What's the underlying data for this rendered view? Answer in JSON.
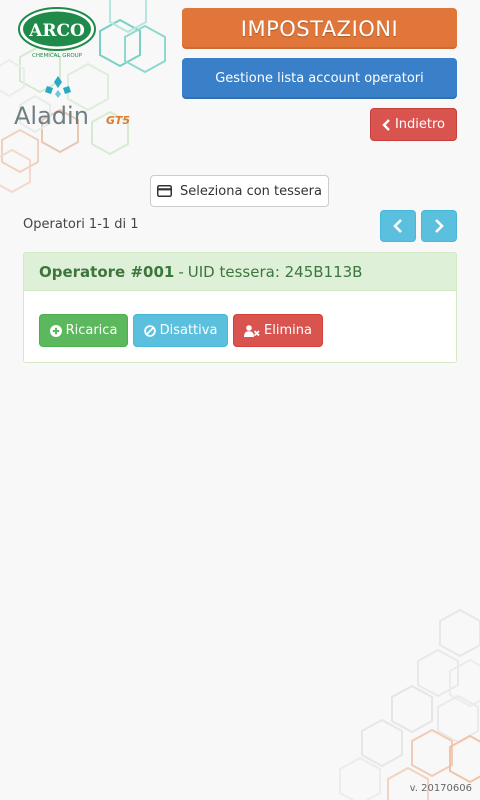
{
  "header": {
    "title": "IMPOSTAZIONI",
    "subtitle": "Gestione lista account operatori",
    "back_label": "Indietro"
  },
  "logos": {
    "arco_text": "ARCO",
    "arco_sub": "CHEMICAL GROUP",
    "aladin_text": "Aladin",
    "aladin_model": "GT5"
  },
  "select_card": {
    "label": "Seleziona con tessera"
  },
  "pager": {
    "info": "Operatori 1-1 di 1"
  },
  "operators": [
    {
      "name": "Operatore #001",
      "separator": "-",
      "uid": "UID tessera: 245B113B",
      "actions": {
        "recharge": "Ricarica",
        "disable": "Disattiva",
        "delete": "Elimina"
      }
    }
  ],
  "footer": {
    "version": "v. 20170606"
  },
  "colors": {
    "title_bg": "#e0763a",
    "subtitle_bg": "#3a80c8",
    "danger": "#d9534f",
    "info": "#5bc0de",
    "success": "#5cb85c",
    "panel_head_bg": "#dff0d8"
  }
}
